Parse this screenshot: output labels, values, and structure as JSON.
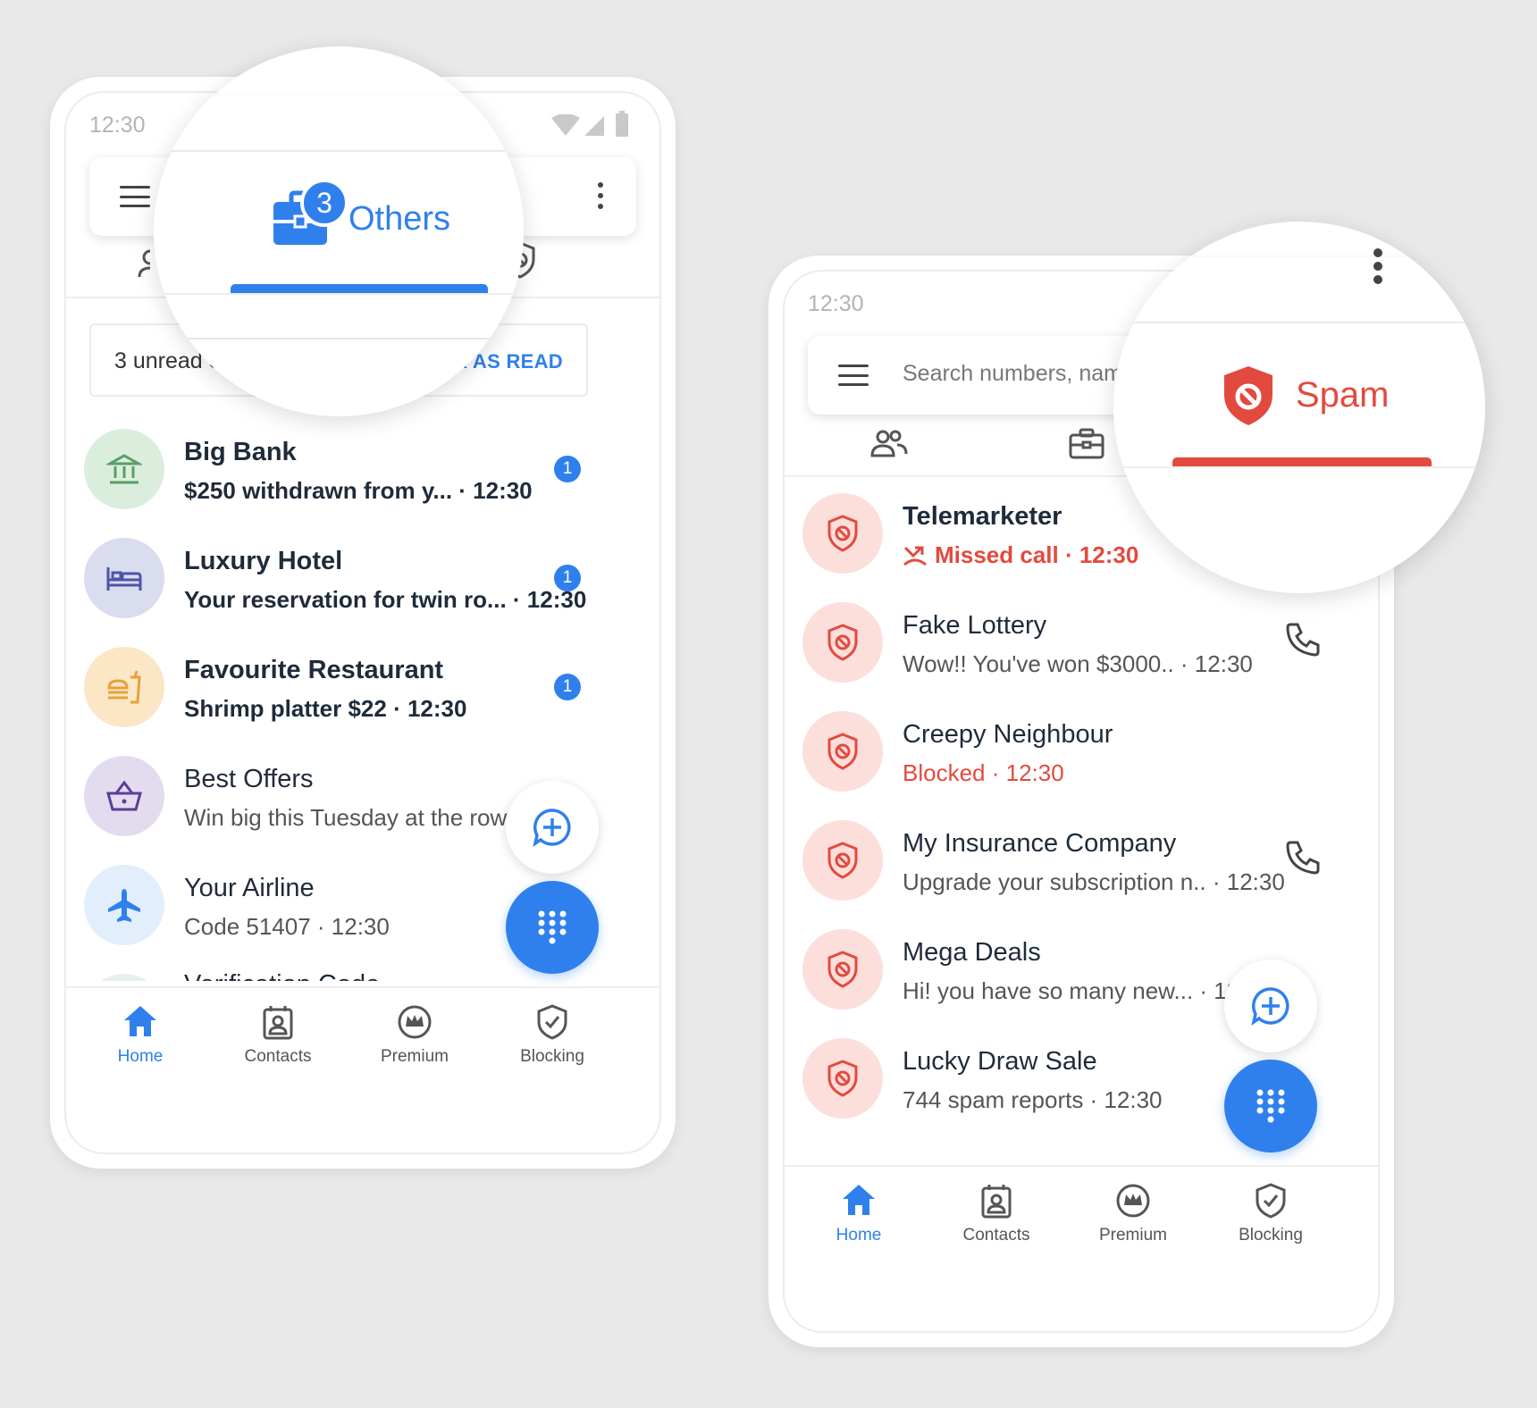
{
  "left_phone": {
    "status_time": "12:30",
    "active_tab": {
      "label": "Others",
      "badge": "3"
    },
    "banner": {
      "text": "3 unread c",
      "action": "MARK AS READ"
    },
    "rows": [
      {
        "name": "Big Bank",
        "sub": "$250 withdrawn from y... · 12:30",
        "unread": "1",
        "icon": "bank-icon"
      },
      {
        "name": "Luxury Hotel",
        "sub": "Your reservation for twin ro... · 12:30",
        "unread": "1",
        "icon": "bed-icon"
      },
      {
        "name": "Favourite Restaurant",
        "sub": "Shrimp platter $22 · 12:30",
        "unread": "1",
        "icon": "food-icon"
      },
      {
        "name": "Best Offers",
        "sub": "Win big this Tuesday at the row... · 12:30",
        "icon": "basket-icon"
      },
      {
        "name": "Your Airline",
        "sub": "Code 51407 · 12:30",
        "icon": "airplane-icon"
      },
      {
        "name": "Verification Code"
      }
    ],
    "nav": [
      {
        "label": "Home",
        "icon": "home-icon"
      },
      {
        "label": "Contacts",
        "icon": "contacts-icon"
      },
      {
        "label": "Premium",
        "icon": "crown-icon"
      },
      {
        "label": "Blocking",
        "icon": "shield-check-icon"
      }
    ]
  },
  "right_phone": {
    "status_time": "12:30",
    "search_placeholder": "Search numbers, names",
    "active_tab": {
      "label": "Spam"
    },
    "rows": [
      {
        "name": "Telemarketer",
        "sub": "Missed call · 12:30",
        "sub_style": "missed"
      },
      {
        "name": "Fake Lottery",
        "sub": "Wow!! You've won $3000.. · 12:30",
        "call": true
      },
      {
        "name": "Creepy Neighbour",
        "sub": "Blocked · 12:30",
        "sub_style": "blocked"
      },
      {
        "name": "My Insurance Company",
        "sub": "Upgrade your subscription n.. · 12:30",
        "call": true
      },
      {
        "name": "Mega Deals",
        "sub": "Hi! you have so many new... · 12:30"
      },
      {
        "name": "Lucky Draw Sale",
        "sub": "744 spam reports · 12:30"
      }
    ],
    "nav": [
      {
        "label": "Home",
        "icon": "home-icon"
      },
      {
        "label": "Contacts",
        "icon": "contacts-icon"
      },
      {
        "label": "Premium",
        "icon": "crown-icon"
      },
      {
        "label": "Blocking",
        "icon": "shield-check-icon"
      }
    ]
  },
  "colors": {
    "accent_blue": "#2f80ed",
    "spam_red": "#e34a3e",
    "text_dark": "#1f2b3a"
  }
}
